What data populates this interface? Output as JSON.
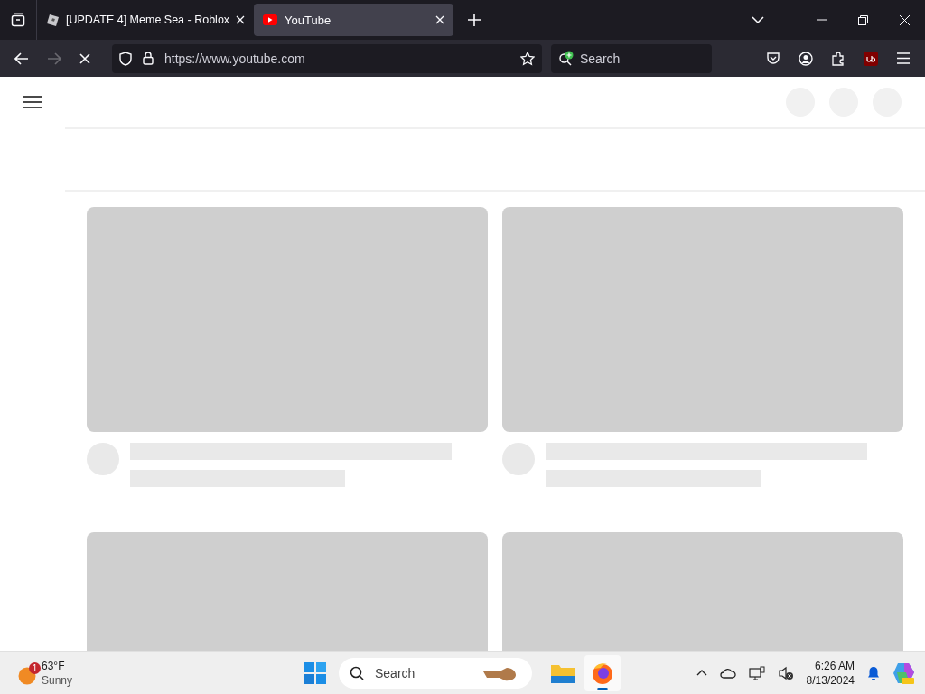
{
  "tabs": [
    {
      "title": "[UPDATE 4] Meme Sea - Roblox",
      "kind": "roblox",
      "selected": false
    },
    {
      "title": "YouTube",
      "kind": "youtube",
      "selected": true
    }
  ],
  "navigation": {
    "loading": true,
    "url": "https://www.youtube.com",
    "search_placeholder": "Search"
  },
  "taskbar": {
    "weather": {
      "badge": "1",
      "temperature": "63°F",
      "condition": "Sunny"
    },
    "search_placeholder": "Search",
    "apps": [
      {
        "kind": "explorer",
        "active": false
      },
      {
        "kind": "firefox",
        "active": true
      }
    ],
    "time": "6:26 AM",
    "date": "8/13/2024"
  }
}
